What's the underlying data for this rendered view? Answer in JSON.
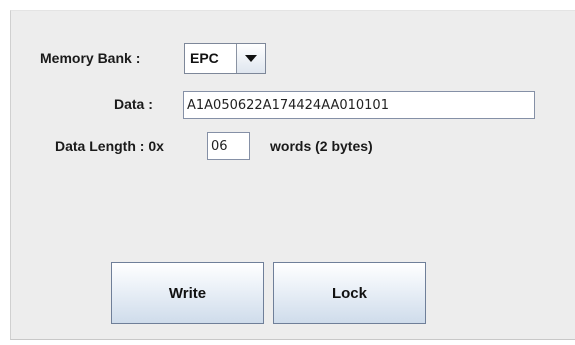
{
  "form": {
    "memory_bank_label": "Memory Bank :",
    "memory_bank_value": "EPC",
    "data_label": "Data :",
    "data_value": "A1A050622A174424AA010101",
    "data_length_label": "Data Length : 0x",
    "data_length_value": "06",
    "data_length_unit": "words (2 bytes)"
  },
  "buttons": {
    "write_label": "Write",
    "lock_label": "Lock"
  },
  "icons": {
    "combo_arrow": "triangle-down-icon"
  }
}
